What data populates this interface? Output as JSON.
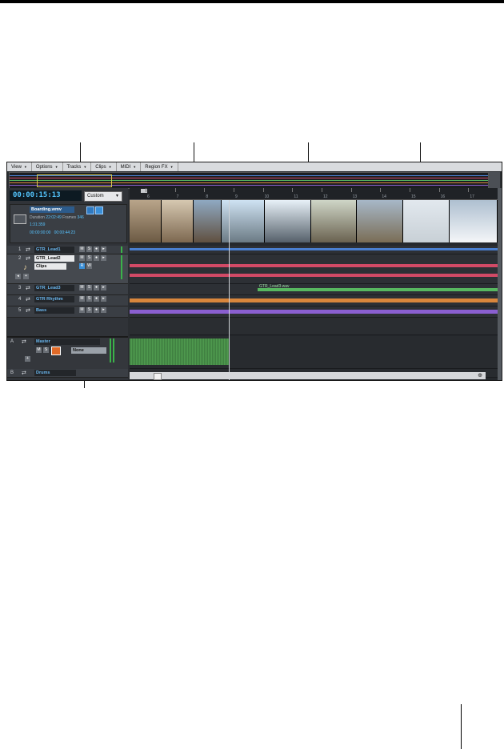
{
  "menubar": [
    {
      "label": "View"
    },
    {
      "label": "Options"
    },
    {
      "label": "Tracks"
    },
    {
      "label": "Clips"
    },
    {
      "label": "MIDI"
    },
    {
      "label": "Region FX"
    }
  ],
  "transport": {
    "timecode": "00:00:15:13",
    "view_preset": "Custom"
  },
  "video_track": {
    "name": "Boarding.wmv",
    "duration_label": "Duration",
    "duration": "22:02:49",
    "frames_label": "Frames",
    "frames": "346",
    "fps": "1:31:359",
    "start": "00:00:00:00",
    "end": "00:00:44:23"
  },
  "ruler": {
    "markers": [
      "6",
      "7",
      "8",
      "9",
      "10",
      "11",
      "12",
      "13",
      "14",
      "15",
      "16",
      "17"
    ]
  },
  "tracks": [
    {
      "number": "1",
      "name": "GTR_Lead1",
      "selected": false
    },
    {
      "number": "2",
      "name": "GTR_Lead2",
      "selected": true,
      "input": "Clips"
    },
    {
      "number": "3",
      "name": "GTR_Lead3",
      "selected": false
    },
    {
      "number": "4",
      "name": "GTR Rhythm",
      "selected": false
    },
    {
      "number": "5",
      "name": "Bass",
      "selected": false
    }
  ],
  "bus_tracks": [
    {
      "number": "A",
      "name": "Master",
      "output": "None"
    },
    {
      "number": "B",
      "name": "Drums"
    }
  ],
  "clip_label": "GTR_Lead3.wav",
  "colors": {
    "accent_blue": "#55c6ff",
    "wave_blue": "#4a7fd0",
    "wave_red": "#d24a66",
    "wave_green": "#57b860",
    "wave_orange": "#d9863c",
    "wave_purple": "#8a5fd0",
    "callout": "#e0001a"
  }
}
